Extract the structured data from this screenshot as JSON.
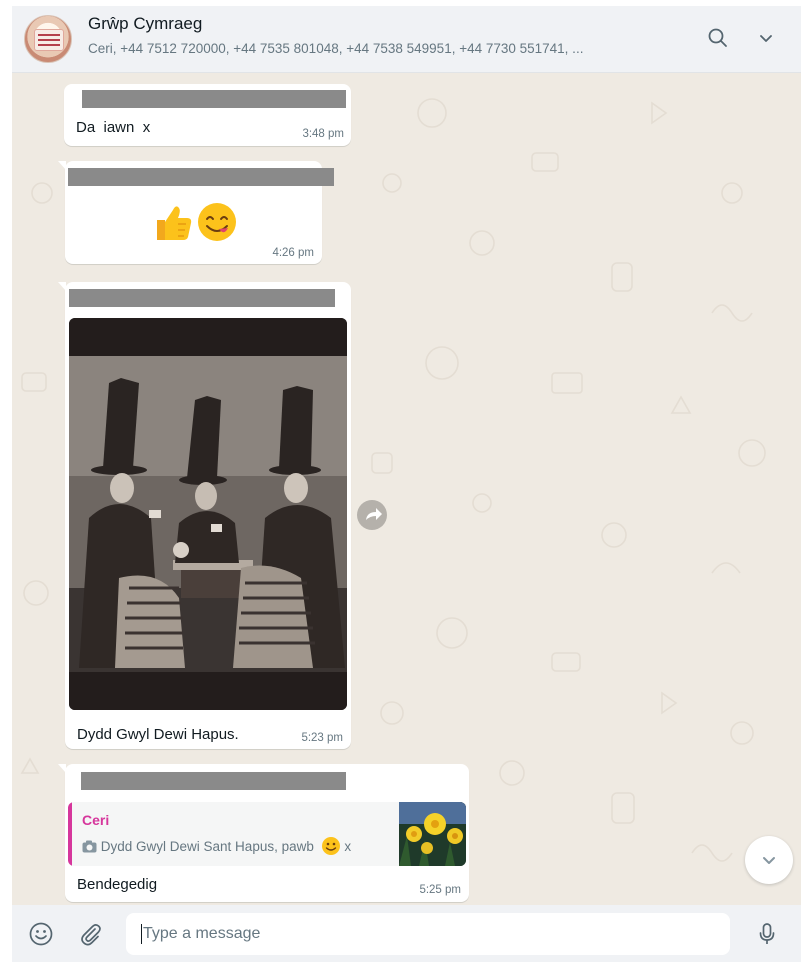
{
  "header": {
    "group_name": "Grŵp Cymraeg",
    "members": "Ceri, +44 7512 720000, +44 7535 801048, +44 7538 549951, +44 7730 551741, ...",
    "icons": [
      "search-icon",
      "chevron-down-icon"
    ]
  },
  "messages": [
    {
      "text": "Da  iawn  x",
      "time": "3:48 pm"
    },
    {
      "emoji": "👍😋",
      "time": "4:26 pm"
    },
    {
      "caption": "Dydd Gwyl Dewi Hapus.",
      "time": "5:23 pm"
    },
    {
      "quoted_author": "Ceri",
      "quoted_text": "Dydd Gwyl Dewi Sant Hapus, pawb",
      "quoted_suffix": "x",
      "text": "Bendegedig",
      "time": "5:25 pm"
    }
  ],
  "composer": {
    "placeholder": "Type a message",
    "icons": [
      "emoji-icon",
      "paperclip-icon",
      "microphone-icon"
    ]
  },
  "colors": {
    "accent_quote": "#d6369c",
    "wallpaper": "#efeae2",
    "bubble": "#ffffff"
  }
}
